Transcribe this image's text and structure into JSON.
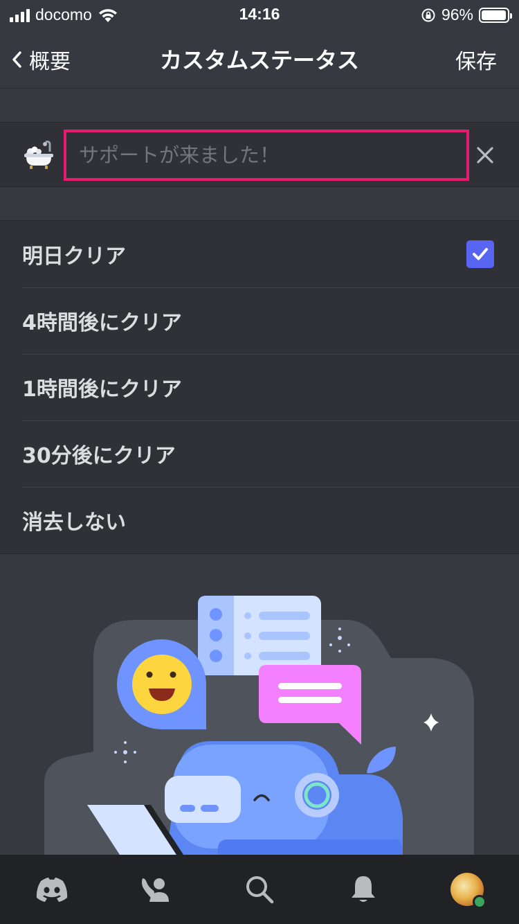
{
  "status_bar": {
    "carrier": "docomo",
    "time": "14:16",
    "battery": "96%",
    "battery_level": 0.96
  },
  "nav": {
    "back_label": "概要",
    "title": "カスタムステータス",
    "save_label": "保存"
  },
  "status_input": {
    "emoji": "bathtub-emoji",
    "placeholder": "サポートが来ました！",
    "value": ""
  },
  "clear_options": [
    {
      "label": "明日クリア",
      "selected": true
    },
    {
      "label": "4時間後にクリア",
      "selected": false
    },
    {
      "label": "1時間後にクリア",
      "selected": false
    },
    {
      "label": "30分後にクリア",
      "selected": false
    },
    {
      "label": "消去しない",
      "selected": false
    }
  ],
  "tabs": [
    "home-icon",
    "friends-icon",
    "search-icon",
    "notifications-icon",
    "profile-avatar"
  ],
  "colors": {
    "accent": "#5865f2",
    "highlight_border": "#e61a6f",
    "online": "#3ba55d"
  }
}
